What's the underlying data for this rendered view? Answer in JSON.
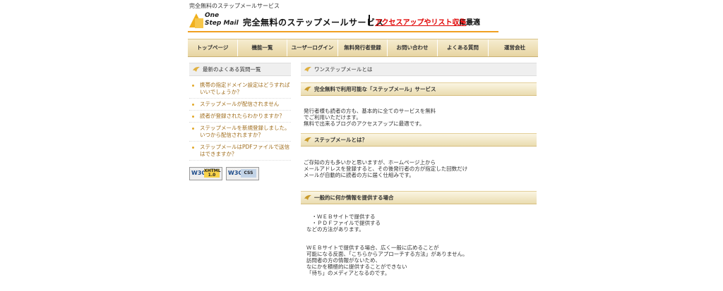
{
  "top_caption": "完全無料のステップメールサービス",
  "header": {
    "logo_line1": "One",
    "logo_line2": "Step Mail",
    "title": "完全無料のステップメールサービス",
    "tagline_highlight": "アクセスアップやリスト収集",
    "tagline_rest": "に最適"
  },
  "nav": [
    {
      "label": "トップページ"
    },
    {
      "label": "機能一覧"
    },
    {
      "label": "ユーザーログイン"
    },
    {
      "label": "無料発行者登録"
    },
    {
      "label": "お問い合わせ"
    },
    {
      "label": "よくある質問"
    },
    {
      "label": "運営会社"
    }
  ],
  "sidebar": {
    "heading": "最新のよくある質問一覧",
    "faq": [
      "携帯の指定ドメイン設定はどうすればいいでしょうか？",
      "ステップメールが配信されません",
      "読者が登録されたらわかりますか？",
      "ステップメールを新規登録しました。いつから配信されますか？",
      "ステップメールはPDFファイルで送信はできますか？"
    ],
    "badge_xhtml": "XHTML 1.0",
    "badge_css": "CSS",
    "badge_w3c": "W3C"
  },
  "main": {
    "page_heading": "ワンステップメールとは",
    "sec1_heading": "完全無料で利用可能な「ステップメール」サービス",
    "sec1_text": "発行者様も読者の方も、基本的に全てのサービスを無料\nでご利用いただけます。\n無料で出来るブログのアクセスアップに最適です。",
    "sec2_heading": "ステップメールとは？",
    "sec2_text": "ご存知の方も多いかと思いますが、ホームページ上から\nメールアドレスを登録すると、その後発行者の方が指定した回数だけ\nメールが自動的に読者の方に届く仕組みです。",
    "sec3_heading": "一般的に何か情報を提供する場合",
    "sec3_list": "　・ＷＥＢサイトで提供する\n　・ＰＤＦファイルで提供する\nなどの方法があります。",
    "sec3_text": "ＷＥＢサイトで提供する場合、広く一般に広めることが\n可能になる反面、「こちらからアプローチする方法」がありません。\n訪問者の方の情報がないため、\nなにかを積極的に提供することができない\n「待ち」のメディアとなるのです。"
  },
  "colors": {
    "accent": "#f0a020",
    "highlight": "#e00000",
    "link": "#a06d1c"
  }
}
